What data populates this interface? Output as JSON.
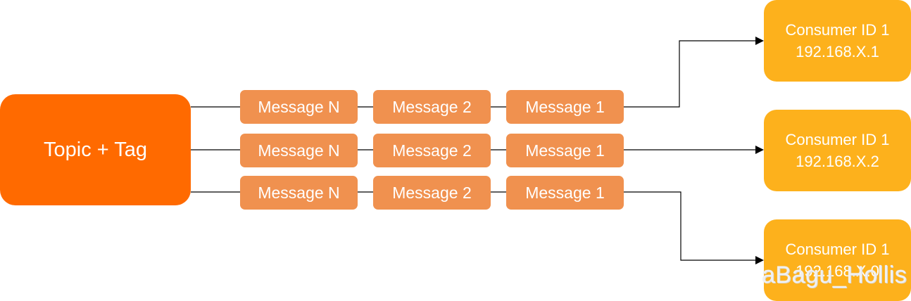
{
  "topic": {
    "label": "Topic + Tag",
    "color": "#ff6a00"
  },
  "queues": [
    {
      "messages": [
        "Message N",
        "Message 2",
        "Message 1"
      ]
    },
    {
      "messages": [
        "Message N",
        "Message 2",
        "Message 1"
      ]
    },
    {
      "messages": [
        "Message N",
        "Message 2",
        "Message 1"
      ]
    }
  ],
  "message_color": "#f0914f",
  "consumers": [
    {
      "name": "Consumer ID 1",
      "address": "192.168.X.1"
    },
    {
      "name": "Consumer ID 1",
      "address": "192.168.X.2"
    },
    {
      "name": "Consumer ID 1",
      "address": "192.168.X.0"
    }
  ],
  "consumer_color": "#fdb11c",
  "watermark": "aBagu_Hollis"
}
